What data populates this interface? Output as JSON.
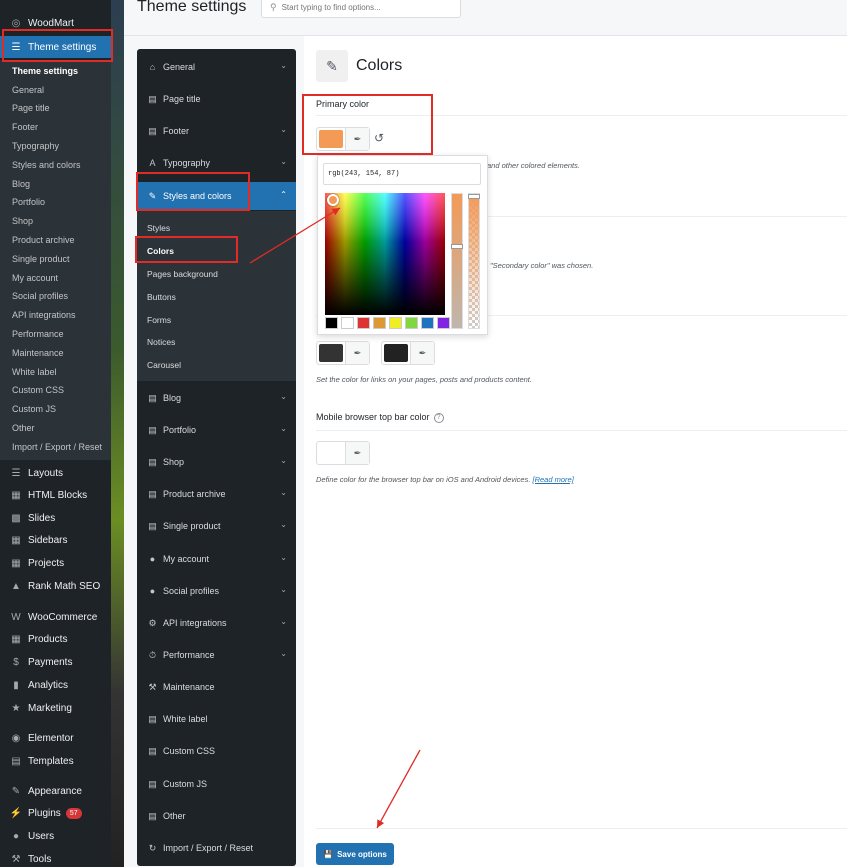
{
  "wp_menu": {
    "top_items_a": [
      {
        "label": "WoodMart",
        "icon": "woodmart-icon"
      },
      {
        "label": "Theme settings",
        "icon": "sliders-icon"
      }
    ],
    "submenu": [
      "Theme settings",
      "General",
      "Page title",
      "Footer",
      "Typography",
      "Styles and colors",
      "Blog",
      "Portfolio",
      "Shop",
      "Product archive",
      "Single product",
      "My account",
      "Social profiles",
      "API integrations",
      "Performance",
      "Maintenance",
      "White label",
      "Custom CSS",
      "Custom JS",
      "Other",
      "Import / Export / Reset"
    ],
    "top_items_b": [
      {
        "label": "Layouts",
        "icon": "layers-icon"
      },
      {
        "label": "HTML Blocks",
        "icon": "html-blocks-icon"
      },
      {
        "label": "Slides",
        "icon": "slides-icon"
      },
      {
        "label": "Sidebars",
        "icon": "sidebars-icon"
      },
      {
        "label": "Projects",
        "icon": "projects-icon"
      },
      {
        "label": "Rank Math SEO",
        "icon": "rank-math-icon"
      },
      {
        "label": "WooCommerce",
        "icon": "woocommerce-icon"
      },
      {
        "label": "Products",
        "icon": "products-icon"
      },
      {
        "label": "Payments",
        "icon": "payments-icon"
      },
      {
        "label": "Analytics",
        "icon": "analytics-icon"
      },
      {
        "label": "Marketing",
        "icon": "marketing-icon"
      },
      {
        "label": "Elementor",
        "icon": "elementor-icon"
      },
      {
        "label": "Templates",
        "icon": "templates-icon"
      },
      {
        "label": "Appearance",
        "icon": "appearance-icon"
      },
      {
        "label": "Plugins",
        "icon": "plugins-icon",
        "badge": "57"
      },
      {
        "label": "Users",
        "icon": "users-icon"
      },
      {
        "label": "Tools",
        "icon": "tools-icon"
      }
    ]
  },
  "header": {
    "title": "Theme settings",
    "search_placeholder": "Start typing to find options..."
  },
  "options_nav": {
    "items_top": [
      {
        "label": "General",
        "icon": "general-icon"
      },
      {
        "label": "Page title",
        "icon": "page-title-icon"
      },
      {
        "label": "Footer",
        "icon": "footer-icon"
      },
      {
        "label": "Typography",
        "icon": "typography-icon"
      },
      {
        "label": "Styles and colors",
        "icon": "brush-icon"
      }
    ],
    "sub_items": [
      "Styles",
      "Colors",
      "Pages background",
      "Buttons",
      "Forms",
      "Notices",
      "Carousel"
    ],
    "items_bottom": [
      {
        "label": "Blog",
        "icon": "blog-icon"
      },
      {
        "label": "Portfolio",
        "icon": "portfolio-icon"
      },
      {
        "label": "Shop",
        "icon": "shop-icon"
      },
      {
        "label": "Product archive",
        "icon": "product-archive-icon"
      },
      {
        "label": "Single product",
        "icon": "single-product-icon"
      },
      {
        "label": "My account",
        "icon": "my-account-icon"
      },
      {
        "label": "Social profiles",
        "icon": "social-profiles-icon"
      },
      {
        "label": "API integrations",
        "icon": "api-icon"
      },
      {
        "label": "Performance",
        "icon": "performance-icon"
      },
      {
        "label": "Maintenance",
        "icon": "maintenance-icon"
      },
      {
        "label": "White label",
        "icon": "white-label-icon"
      },
      {
        "label": "Custom CSS",
        "icon": "custom-css-icon"
      },
      {
        "label": "Custom JS",
        "icon": "custom-js-icon"
      },
      {
        "label": "Other",
        "icon": "other-icon"
      },
      {
        "label": "Import / Export / Reset",
        "icon": "import-export-icon"
      }
    ]
  },
  "content": {
    "section_title": "Colors",
    "primary_color": {
      "label": "Primary color",
      "swatch": "#f39a57",
      "help_partial": "and other colored elements."
    },
    "secondary_help_partial": "\"Secondary color\" was chosen.",
    "link_colors": {
      "swatch_1": "#333333",
      "swatch_2": "#222222",
      "help": "Set the color for links on your pages, posts and products content."
    },
    "mobile_bar": {
      "label": "Mobile browser top bar color",
      "swatch": "#ffffff",
      "help": "Define color for the browser top bar on iOS and Android devices.",
      "read_more": "[Read more]"
    },
    "save_label": "Save options"
  },
  "picker": {
    "value": "rgb(243, 154, 87)",
    "palette": [
      "#000000",
      "#ffffff",
      "#dd3333",
      "#dd9933",
      "#eeee22",
      "#81d742",
      "#1e73be",
      "#8224e3"
    ]
  }
}
